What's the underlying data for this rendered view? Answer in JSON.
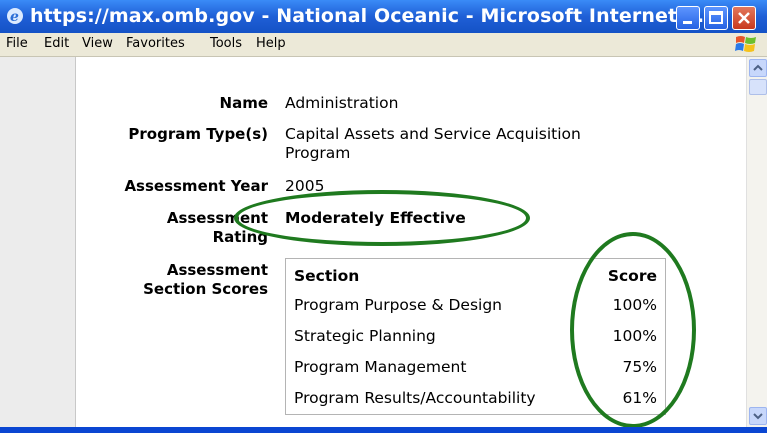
{
  "window": {
    "title": "https://max.omb.gov - National Oceanic - Microsoft Internet E..."
  },
  "menu": [
    "File",
    "Edit",
    "View",
    "Favorites",
    "Tools",
    "Help"
  ],
  "program": {
    "name_label": "Name",
    "name_value": "Administration",
    "type_label": "Program Type(s)",
    "type_value_line1": "Capital Assets and Service Acquisition",
    "type_value_line2": "Program",
    "year_label": "Assessment Year",
    "year_value": "2005",
    "rating_label_line1": "Assessment",
    "rating_label_line2": "Rating",
    "rating_value": "Moderately Effective",
    "scores_label_line1": "Assessment",
    "scores_label_line2": "Section Scores"
  },
  "scores": {
    "header_section": "Section",
    "header_score": "Score",
    "rows": [
      {
        "section": "Program Purpose & Design",
        "score": "100%"
      },
      {
        "section": "Strategic Planning",
        "score": "100%"
      },
      {
        "section": "Program Management",
        "score": "75%"
      },
      {
        "section": "Program Results/Accountability",
        "score": "61%"
      }
    ]
  },
  "colors": {
    "titlebar": "#1f5fd6",
    "highlight_oval": "#1f7a1f"
  }
}
